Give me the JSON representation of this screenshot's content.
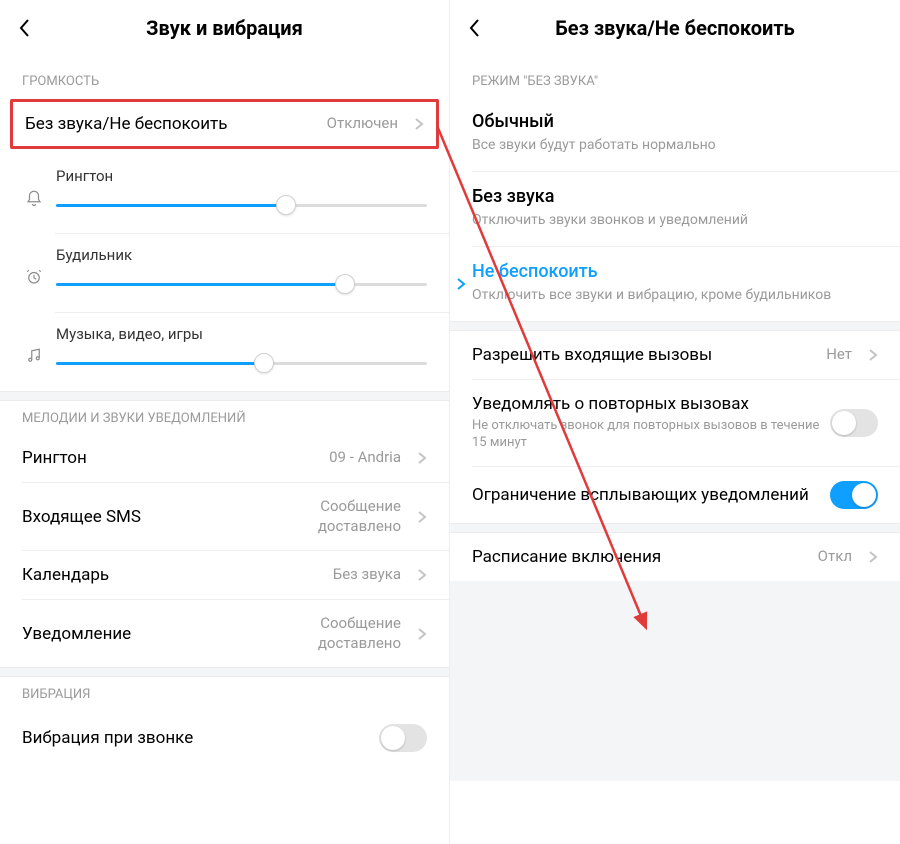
{
  "left": {
    "title": "Звук и вибрация",
    "sections": {
      "volume_label": "ГРОМКОСТЬ",
      "dnd": {
        "label": "Без звука/Не беспокоить",
        "value": "Отключен"
      },
      "sliders": {
        "ringtone": {
          "label": "Рингтон",
          "pct": 62
        },
        "alarm": {
          "label": "Будильник",
          "pct": 78
        },
        "media": {
          "label": "Музыка, видео, игры",
          "pct": 56
        }
      },
      "melodies_label": "МЕЛОДИИ И ЗВУКИ УВЕДОМЛЕНИЙ",
      "ringtone_row": {
        "label": "Рингтон",
        "value": "09 - Andria"
      },
      "sms_row": {
        "label": "Входящее SMS",
        "value": "Сообщение доставлено"
      },
      "calendar_row": {
        "label": "Календарь",
        "value": "Без звука"
      },
      "notif_row": {
        "label": "Уведомление",
        "value": "Сообщение доставлено"
      },
      "vibration_label": "ВИБРАЦИЯ",
      "vibrate_call": {
        "label": "Вибрация при звонке"
      }
    }
  },
  "right": {
    "title": "Без звука/Не беспокоить",
    "mode_label": "РЕЖИМ \"БЕЗ ЗВУКА\"",
    "modes": {
      "normal": {
        "title": "Обычный",
        "sub": "Все звуки будут работать нормально"
      },
      "silent": {
        "title": "Без звука",
        "sub": "Отключить звуки звонков и уведомлений"
      },
      "dnd": {
        "title": "Не беспокоить",
        "sub": "Отключить все звуки и вибрацию, кроме будильников"
      }
    },
    "allow_calls": {
      "label": "Разрешить входящие вызовы",
      "value": "Нет"
    },
    "repeat_calls": {
      "label": "Уведомлять о повторных вызовах",
      "sub": "Не отключать звонок для повторных вызовов в течение 15 минут"
    },
    "popup_limit": {
      "label": "Ограничение всплывающих уведомлений"
    },
    "schedule": {
      "label": "Расписание включения",
      "value": "Откл"
    }
  },
  "colors": {
    "accent": "#0f9fff",
    "highlight": "#e13a3a"
  }
}
